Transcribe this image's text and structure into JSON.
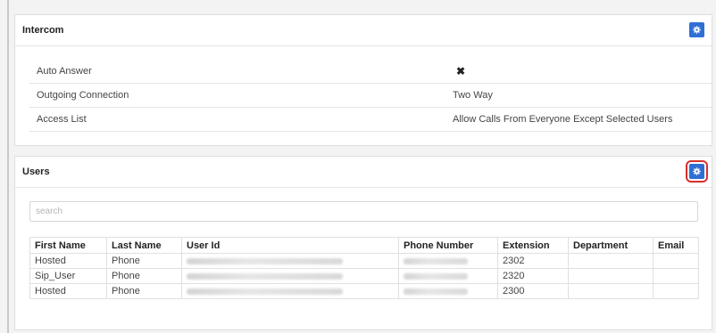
{
  "intercom": {
    "title": "Intercom",
    "rows": [
      {
        "label": "Auto Answer",
        "value": "",
        "icon": "x-mark-icon"
      },
      {
        "label": "Outgoing Connection",
        "value": "Two Way"
      },
      {
        "label": "Access List",
        "value": "Allow Calls From Everyone Except Selected Users"
      }
    ]
  },
  "users": {
    "title": "Users",
    "search_placeholder": "search",
    "columns": [
      "First Name",
      "Last Name",
      "User Id",
      "Phone Number",
      "Extension",
      "Department",
      "Email"
    ],
    "rows": [
      {
        "first_name": "Hosted",
        "last_name": "Phone",
        "user_id": "",
        "phone_number": "",
        "extension": "2302",
        "department": "",
        "email": ""
      },
      {
        "first_name": "Sip_User",
        "last_name": "Phone",
        "user_id": "",
        "phone_number": "",
        "extension": "2320",
        "department": "",
        "email": ""
      },
      {
        "first_name": "Hosted",
        "last_name": "Phone",
        "user_id": "",
        "phone_number": "",
        "extension": "2300",
        "department": "",
        "email": ""
      }
    ]
  },
  "colors": {
    "accent": "#2f6fd4",
    "highlight": "#d9302f"
  },
  "icons": {
    "settings": "gear-icon",
    "auto_answer": "x-mark-icon"
  }
}
